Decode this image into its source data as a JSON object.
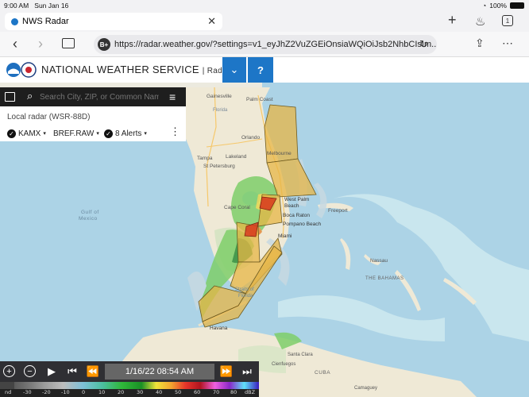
{
  "status": {
    "time": "9:00 AM",
    "date": "Sun Jan 16",
    "battery": "100%"
  },
  "tab": {
    "title": "NWS Radar"
  },
  "tabbar": {
    "tab_count": "1"
  },
  "address": {
    "url": "https://radar.weather.gov/?settings=v1_eyJhZ2VuZGEiOnsiaWQiOiJsb2NhbCIsIm..."
  },
  "header": {
    "title": "NATIONAL WEATHER SERVICE",
    "section": "| Radar",
    "help": "?"
  },
  "search": {
    "placeholder": "Search City, ZIP, or Common Name"
  },
  "panel": {
    "title": "Local radar (WSR-88D)",
    "station": "KAMX",
    "product": "BREF.RAW",
    "alerts": "8 Alerts"
  },
  "timeline": {
    "timestamp": "1/16/22 08:54 AM"
  },
  "legend": {
    "labels": [
      "nd",
      "-30",
      "-20",
      "-10",
      "0",
      "10",
      "20",
      "30",
      "40",
      "50",
      "60",
      "70",
      "80",
      "dBZ"
    ]
  },
  "map_labels": {
    "gainesville": "Gainesville",
    "florida": "Florida",
    "palm_coast": "Palm Coast",
    "orlando": "Orlando",
    "melbourne": "Melbourne",
    "tampa": "Tampa",
    "lakeland": "Lakeland",
    "st_petersburg": "St Petersburg",
    "cape_coral": "Cape Coral",
    "west_palm": "West Palm",
    "beach": "Beach",
    "boca_raton": "Boca Raton",
    "pompano": "Pompano Beach",
    "miami": "Miami",
    "freeport": "Freeport",
    "gulf": "Gulf of",
    "mexico": "Mexico",
    "nassau": "Nassau",
    "bahamas": "THE BAHAMAS",
    "straits": "Straits of",
    "straits2": "Florida",
    "havana": "Havana",
    "santa_clara": "Santa Clara",
    "cienfuegos": "Cienfuegos",
    "cuba": "CUBA",
    "camaguey": "Camaguey"
  },
  "colors": {
    "header_blue": "#1d76c7",
    "alert_yellow": "#e7b645",
    "alert_red": "#d63a1e",
    "water": "#acd3e6",
    "land": "#f1ede1"
  }
}
